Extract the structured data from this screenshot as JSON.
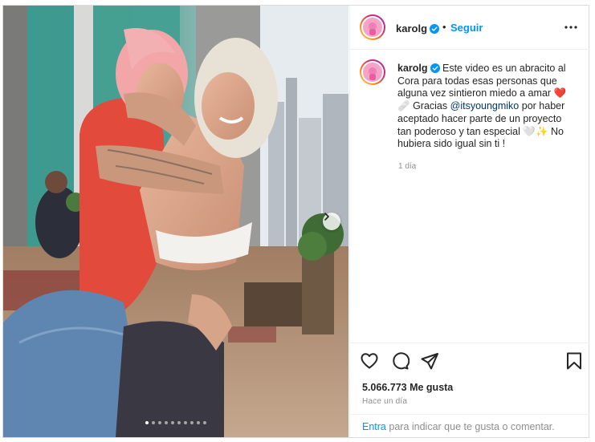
{
  "post": {
    "username": "karolg",
    "separator": "•",
    "follow_label": "Seguir",
    "caption": {
      "username": "karolg",
      "text_part1": "Este video es un abracito al Cora para todas esas personas que alguna vez sintieron miedo a amar",
      "emoji1": "❤️🩹",
      "text_part2": "Gracias",
      "mention": "@itsyoungmiko",
      "text_part3": "por haber aceptado hacer parte de un proyecto tan poderoso y tan especial",
      "emoji2": "🤍✨",
      "text_part4": "No hubiera sido igual sin ti !",
      "time": "1 día"
    },
    "likes": "5.066.773 Me gusta",
    "posted_ago": "Hace un día",
    "comment_prompt_action": "Entra",
    "comment_prompt_rest": "para indicar que te gusta o comentar.",
    "carousel": {
      "total": 10,
      "active_index": 0
    }
  },
  "icons": {
    "verified": "verified-badge-icon",
    "more": "more-options-icon",
    "like": "heart-icon",
    "comment": "comment-icon",
    "share": "send-icon",
    "save": "bookmark-icon",
    "next": "chevron-right-icon"
  },
  "colors": {
    "follow": "#0095f6",
    "mention": "#00376b",
    "secondary_text": "#8e8e8e",
    "verified": "#0095f6"
  }
}
